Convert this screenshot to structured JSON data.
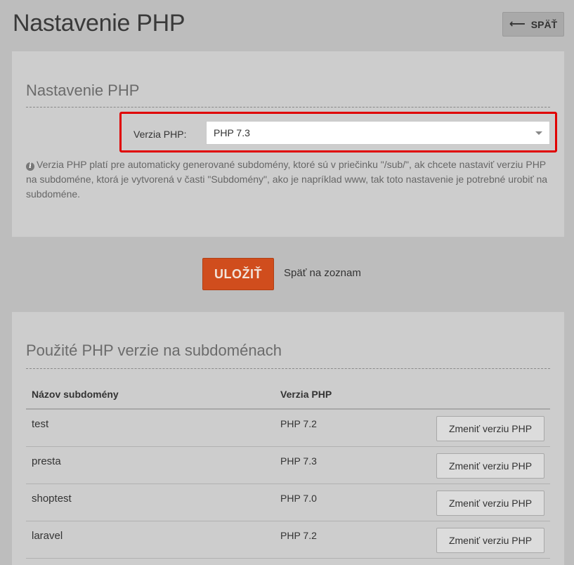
{
  "page": {
    "title": "Nastavenie PHP",
    "back_label": "SPÄŤ",
    "back_icon": "arrow-left-icon"
  },
  "settings": {
    "heading": "Nastavenie PHP",
    "php_label": "Verzia PHP:",
    "php_selected": "PHP 7.3",
    "help_icon": "info-icon",
    "help_text": "Verzia PHP platí pre automaticky generované subdomény, ktoré sú v priečinku \"/sub/\", ak chcete nastaviť verziu PHP na subdoméne, ktorá je vytvorená v časti \"Subdomény\", ako je napríklad www, tak toto nastavenie je potrebné urobiť na subdoméne.",
    "highlight_color": "#e00000"
  },
  "actions": {
    "save_label": "ULOŽIŤ",
    "back_to_list_label": "Späť na zoznam",
    "save_color": "#d04d1d"
  },
  "subdomains": {
    "heading": "Použité PHP verzie na subdoménach",
    "columns": [
      "Názov subdomény",
      "Verzia PHP"
    ],
    "rows": [
      {
        "name": "test",
        "version": "PHP 7.2",
        "action": "Zmeniť verziu PHP"
      },
      {
        "name": "presta",
        "version": "PHP 7.3",
        "action": "Zmeniť verziu PHP"
      },
      {
        "name": "shoptest",
        "version": "PHP 7.0",
        "action": "Zmeniť verziu PHP"
      },
      {
        "name": "laravel",
        "version": "PHP 7.2",
        "action": "Zmeniť verziu PHP"
      }
    ]
  }
}
